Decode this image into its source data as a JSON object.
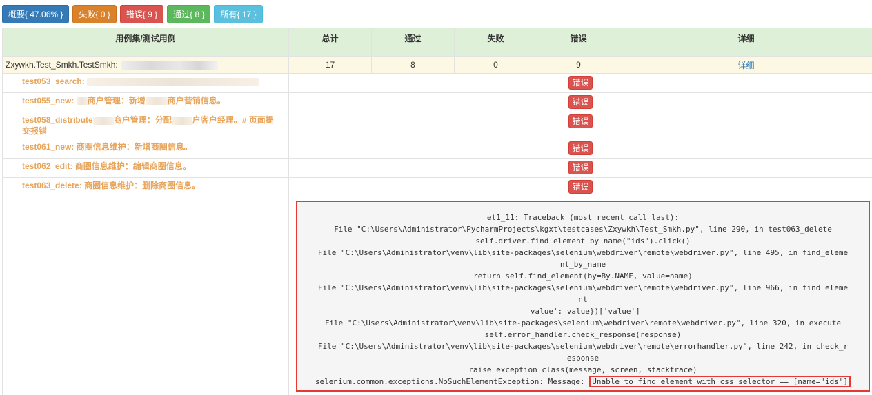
{
  "filters": {
    "summary": "概要{ 47.06% }",
    "fail": "失败{ 0 }",
    "error": "错误{ 9 }",
    "pass": "通过{ 8 }",
    "all": "所有{ 17 }"
  },
  "table": {
    "headers": [
      "用例集/测试用例",
      "总计",
      "通过",
      "失败",
      "错误",
      "详细"
    ],
    "suite": {
      "name": "Zxywkh.Test_Smkh.TestSmkh: ",
      "total": "17",
      "passed": "8",
      "failed": "0",
      "errors": "9",
      "detail": "详细"
    },
    "cases": [
      {
        "name": "test053_search:",
        "desc": "",
        "status": "错误"
      },
      {
        "name": "test055_new:",
        "desc_a": "",
        "desc_b": "商户管理：新增",
        "desc_c": "商户营销信息。",
        "status": "错误"
      },
      {
        "name": "test058_distribute",
        "desc_b": "商户管理：分配",
        "desc_c": "户客户经理。# 页面提",
        "desc_d": "交报错",
        "status": "错误"
      },
      {
        "name": "test061_new:",
        "desc": "商圈信息维护：新增商圈信息。",
        "status": "错误"
      },
      {
        "name": "test062_edit:",
        "desc": "商圈信息维护：编辑商圈信息。",
        "status": "错误"
      },
      {
        "name": "test063_delete:",
        "desc": "商圈信息维护：删除商圈信息。",
        "status": "错误"
      }
    ]
  },
  "traceback": {
    "lines": [
      "et1_11: Traceback (most recent call last):",
      "File \"C:\\Users\\Administrator\\PycharmProjects\\kgxt\\testcases\\Zxywkh\\Test_Smkh.py\", line 290, in test063_delete",
      "self.driver.find_element_by_name(\"ids\").click()",
      "File \"C:\\Users\\Administrator\\venv\\lib\\site-packages\\selenium\\webdriver\\remote\\webdriver.py\", line 495, in find_eleme",
      "nt_by_name",
      "return self.find_element(by=By.NAME, value=name)",
      "File \"C:\\Users\\Administrator\\venv\\lib\\site-packages\\selenium\\webdriver\\remote\\webdriver.py\", line 966, in find_eleme",
      "nt",
      "'value': value})['value']",
      "File \"C:\\Users\\Administrator\\venv\\lib\\site-packages\\selenium\\webdriver\\remote\\webdriver.py\", line 320, in execute",
      "self.error_handler.check_response(response)",
      "File \"C:\\Users\\Administrator\\venv\\lib\\site-packages\\selenium\\webdriver\\remote\\errorhandler.py\", line 242, in check_r",
      "esponse",
      "raise exception_class(message, screen, stacktrace)"
    ],
    "last_prefix": "selenium.common.exceptions.NoSuchElementException: Message: ",
    "last_highlight": "Unable to find element with css selector == [name=\"ids\"]"
  }
}
